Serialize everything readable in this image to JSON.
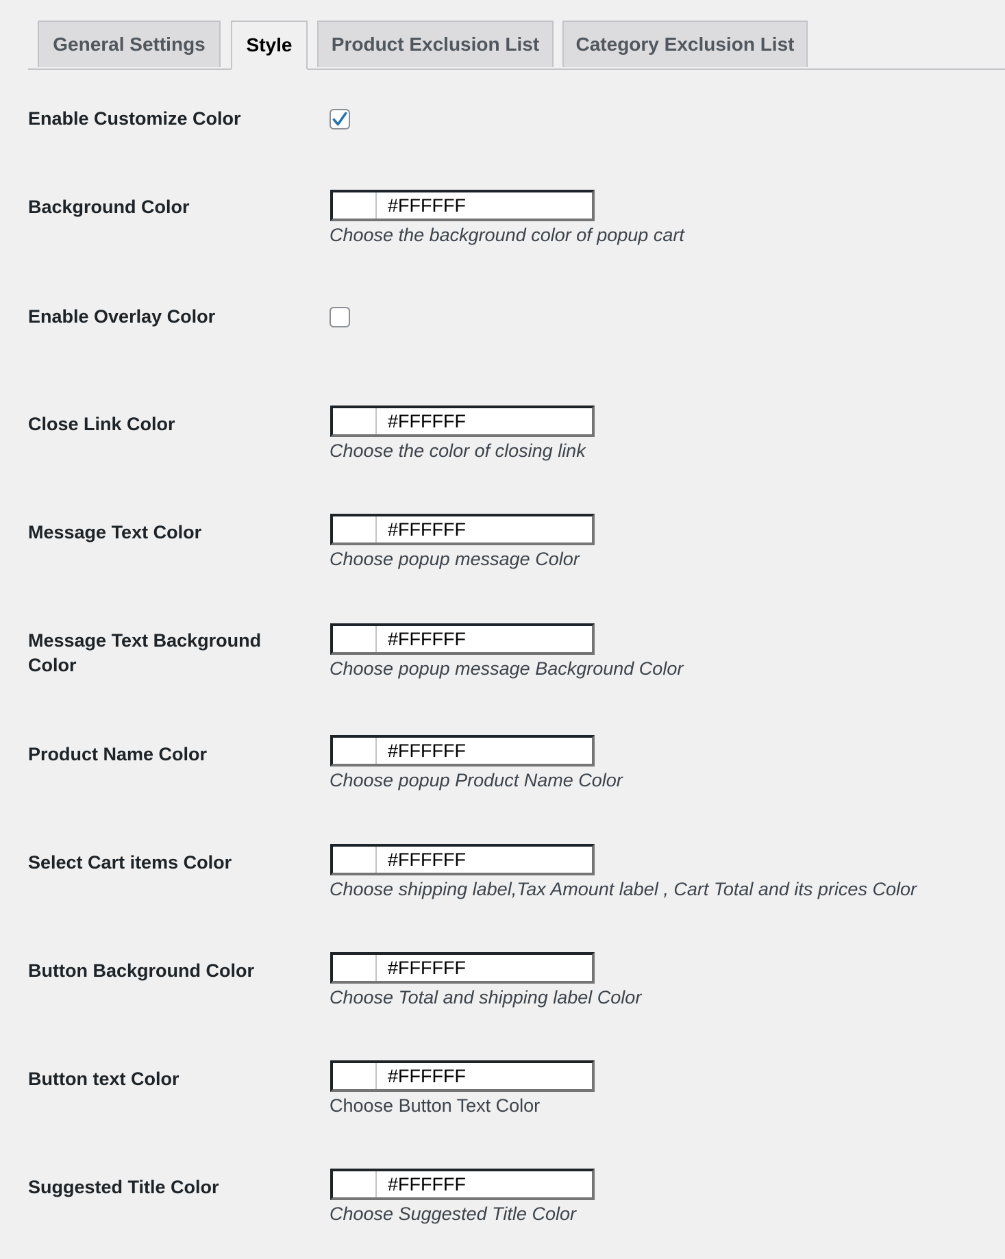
{
  "tabs": [
    {
      "label": "General Settings",
      "active": false
    },
    {
      "label": "Style",
      "active": true
    },
    {
      "label": "Product Exclusion List",
      "active": false
    },
    {
      "label": "Category Exclusion List",
      "active": false
    }
  ],
  "settings": {
    "enable_customize_color": {
      "label": "Enable Customize Color",
      "checked": true
    },
    "background_color": {
      "label": "Background Color",
      "value": "#FFFFFF",
      "description": "Choose the background color of popup cart"
    },
    "enable_overlay_color": {
      "label": "Enable Overlay Color",
      "checked": false
    },
    "close_link_color": {
      "label": "Close Link Color",
      "value": "#FFFFFF",
      "description": "Choose the color of closing link"
    },
    "message_text_color": {
      "label": "Message Text Color",
      "value": "#FFFFFF",
      "description": "Choose popup message Color"
    },
    "message_text_background_color": {
      "label": "Message Text Background Color",
      "value": "#FFFFFF",
      "description": "Choose popup message Background Color"
    },
    "product_name_color": {
      "label": "Product Name Color",
      "value": "#FFFFFF",
      "description": "Choose popup Product Name Color"
    },
    "select_cart_items_color": {
      "label": "Select Cart items Color",
      "value": "#FFFFFF",
      "description": "Choose shipping label,Tax Amount label , Cart Total and its prices Color"
    },
    "button_background_color": {
      "label": "Button Background Color",
      "value": "#FFFFFF",
      "description": "Choose Total and shipping label Color"
    },
    "button_text_color": {
      "label": "Button text Color",
      "value": "#FFFFFF",
      "description": "Choose Button Text Color"
    },
    "suggested_title_color": {
      "label": "Suggested Title Color",
      "value": "#FFFFFF",
      "description": "Choose Suggested Title Color"
    }
  },
  "colors": {
    "page_background": "#f0f0f1",
    "checkbox_accent": "#2271b1",
    "swatch": "#FFFFFF"
  },
  "icons": {
    "checkmark": "checkmark-icon"
  }
}
